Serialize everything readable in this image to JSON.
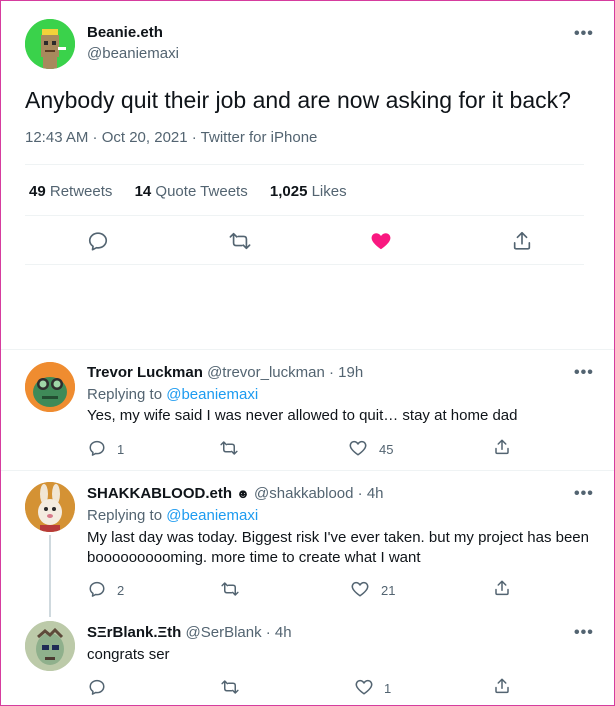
{
  "main_tweet": {
    "display_name": "Beanie.eth",
    "handle": "@beaniemaxi",
    "text": "Anybody quit their job and are now asking for it back?",
    "timestamp": "12:43 AM · Oct 20, 2021 · Twitter for iPhone",
    "stats": [
      {
        "count": "49",
        "label": "Retweets"
      },
      {
        "count": "14",
        "label": "Quote Tweets"
      },
      {
        "count": "1,025",
        "label": "Likes"
      }
    ],
    "liked": true,
    "like_color": "#f91880"
  },
  "replies": [
    {
      "display_name": "Trevor Luckman",
      "handle": "@trevor_luckman",
      "time": "· 19h",
      "replying_prefix": "Replying to",
      "replying_to": "@beaniemaxi",
      "text": "Yes, my wife said I was never allowed to quit… stay at home dad",
      "reply_count": "1",
      "retweet_count": "",
      "like_count": "45"
    },
    {
      "display_name": "SHAKKABLOOD.eth",
      "badge": "☻",
      "handle": "@shakkablood",
      "time": "· 4h",
      "replying_prefix": "Replying to",
      "replying_to": "@beaniemaxi",
      "text_line1": "My last day was today. Biggest risk I've ever taken. but my project has been",
      "text_line2": "boooooooooming. more time to create what I want",
      "reply_count": "2",
      "retweet_count": "",
      "like_count": "21"
    },
    {
      "display_name": "SΞrBlank.Ξth",
      "handle": "@SerBlank",
      "time": "· 4h",
      "text": "congrats ser",
      "reply_count": "",
      "retweet_count": "",
      "like_count": "1"
    }
  ],
  "more_label": "•••",
  "colors": {
    "accent": "#1d9bf0",
    "muted": "#536471",
    "frame": "#d63c9e"
  }
}
